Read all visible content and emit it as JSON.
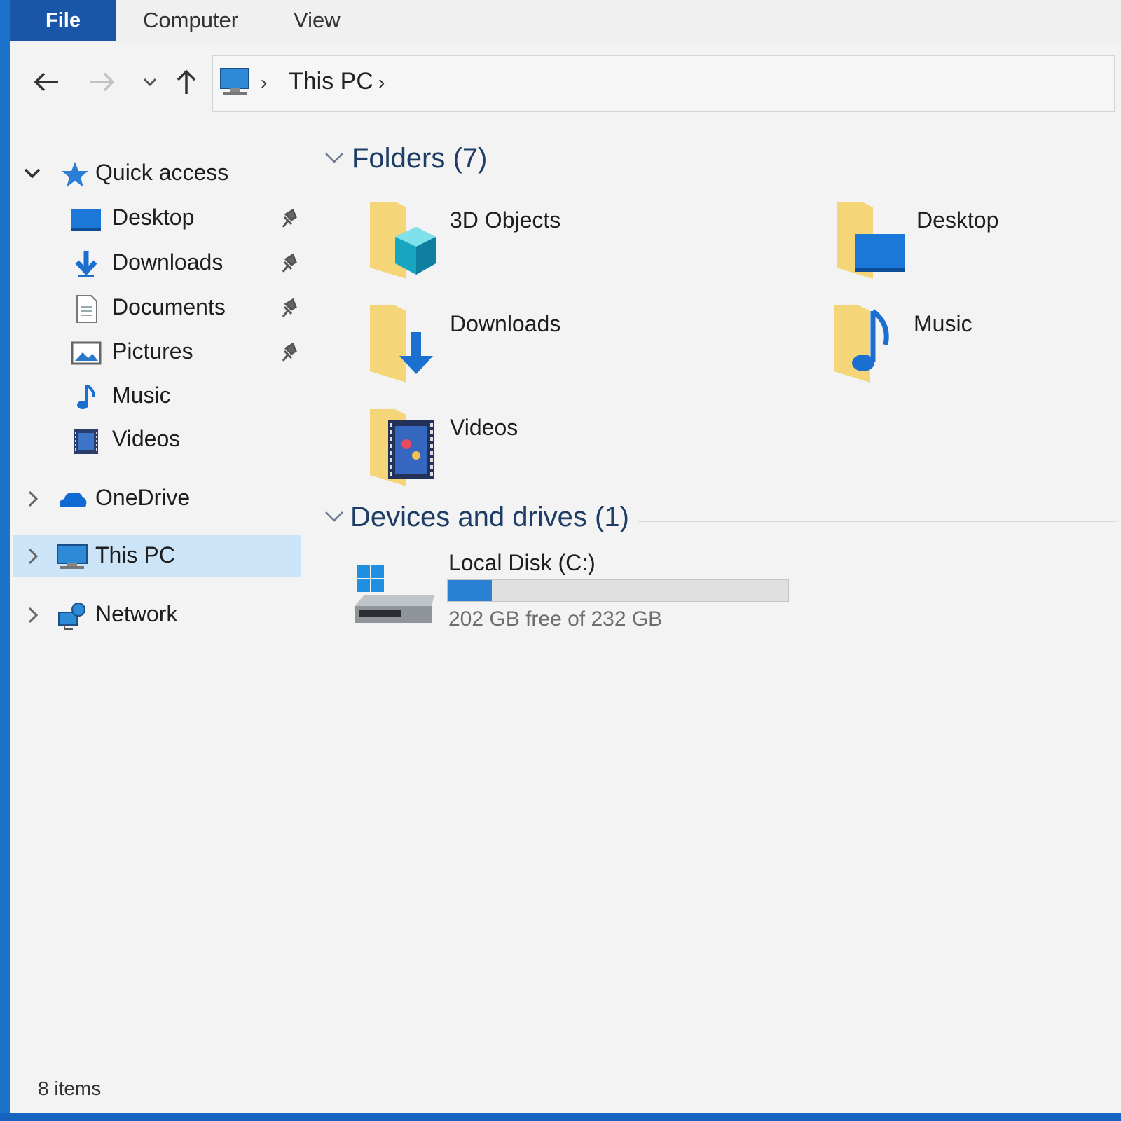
{
  "ribbon": {
    "tabs": [
      "File",
      "Computer",
      "View"
    ]
  },
  "address": {
    "path": "This PC"
  },
  "sidebar": {
    "quick_access_label": "Quick access",
    "quick_items": [
      {
        "label": "Desktop",
        "icon": "desktop-icon",
        "pinned": true
      },
      {
        "label": "Downloads",
        "icon": "downloads-icon",
        "pinned": true
      },
      {
        "label": "Documents",
        "icon": "documents-icon",
        "pinned": true
      },
      {
        "label": "Pictures",
        "icon": "pictures-icon",
        "pinned": true
      },
      {
        "label": "Music",
        "icon": "music-icon",
        "pinned": false
      },
      {
        "label": "Videos",
        "icon": "videos-icon",
        "pinned": false
      }
    ],
    "roots": [
      {
        "label": "OneDrive",
        "icon": "onedrive-icon"
      },
      {
        "label": "This PC",
        "icon": "this-pc-icon",
        "selected": true
      },
      {
        "label": "Network",
        "icon": "network-icon"
      }
    ]
  },
  "content": {
    "folders_heading": "Folders (7)",
    "folders": [
      {
        "label": "3D Objects",
        "icon": "3d-objects-folder-icon"
      },
      {
        "label": "Desktop",
        "icon": "desktop-folder-icon"
      },
      {
        "label": "Downloads",
        "icon": "downloads-folder-icon"
      },
      {
        "label": "Music",
        "icon": "music-folder-icon"
      },
      {
        "label": "Videos",
        "icon": "videos-folder-icon"
      }
    ],
    "devices_heading": "Devices and drives (1)",
    "drive": {
      "name": "Local Disk (C:)",
      "free_text": "202 GB free of 232 GB",
      "used_fraction": 0.13
    }
  },
  "status": {
    "item_count": "8 items"
  },
  "colors": {
    "accent": "#1a56a8",
    "selection": "#cce4f7",
    "folder": "#f2cf6b",
    "drive_bar": "#2a81d4"
  }
}
